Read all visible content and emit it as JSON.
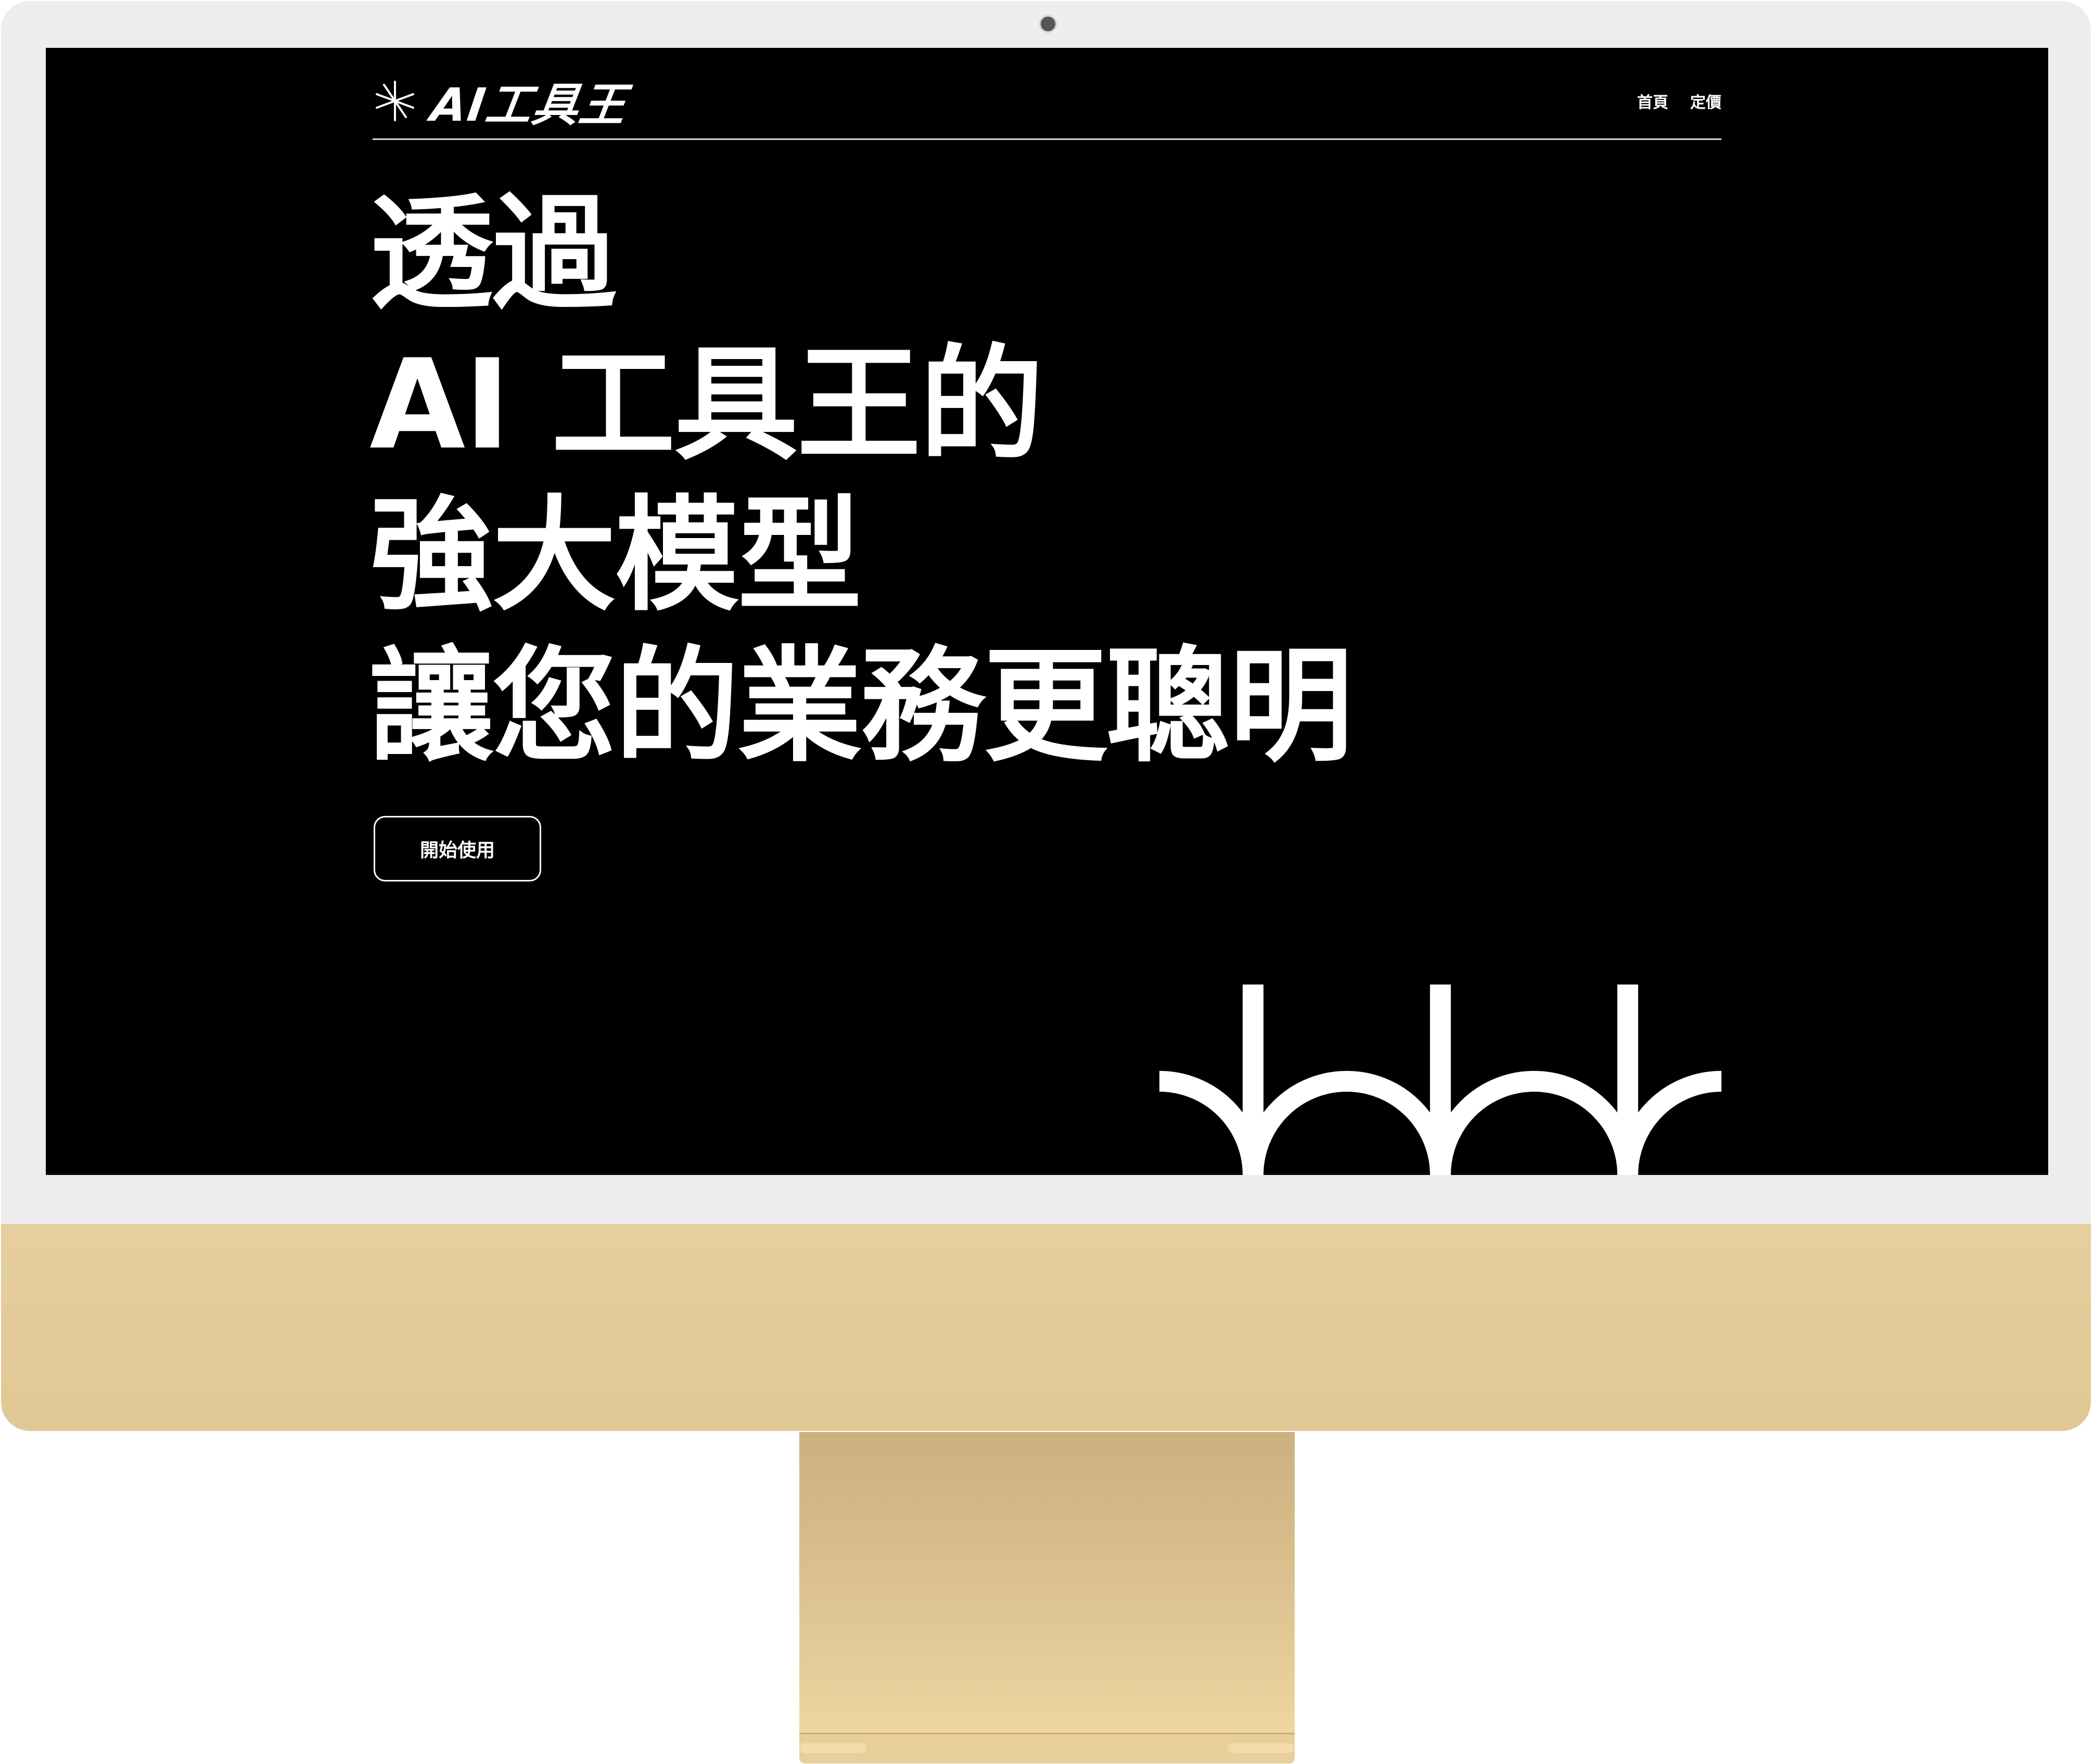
{
  "colors": {
    "screen_background": "#000000",
    "text": "#ffffff",
    "bezel": "#ededf0",
    "monitor_body": "#e2cb9a"
  },
  "header": {
    "logo_icon": "sparkle-asterisk-icon",
    "logo_text": "AI工具王",
    "nav": [
      {
        "label": "首頁"
      },
      {
        "label": "定價"
      }
    ]
  },
  "hero": {
    "title_lines": [
      "透過",
      "AI 工具王的",
      "強大模型",
      "讓您的業務更聰明"
    ],
    "cta_label": "開始使用"
  },
  "decoration": {
    "icon": "arches-pattern-icon"
  }
}
